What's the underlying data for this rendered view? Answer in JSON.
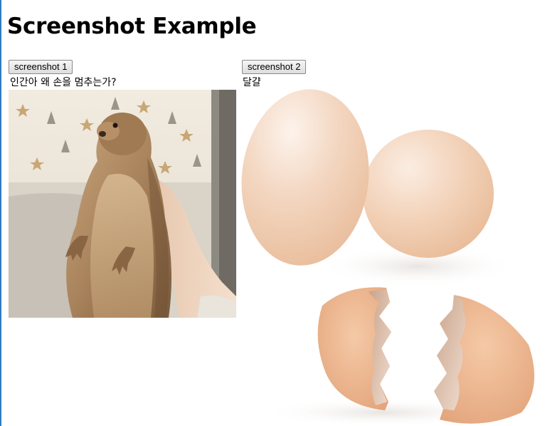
{
  "page": {
    "heading": "Screenshot Example"
  },
  "panel1": {
    "button_label": "screenshot 1",
    "caption": "인간아 왜 손을 멈추는가?",
    "image_icon": "prairie-dog-photo"
  },
  "panel2": {
    "button_label": "screenshot 2",
    "caption": "달걀",
    "image_icon": "eggs-illustration"
  },
  "colors": {
    "window_border": "#2f7ac0",
    "egg_shell": "#f2cfb2",
    "egg_shell_dark": "#e0a981",
    "fur": "#a8835c"
  }
}
